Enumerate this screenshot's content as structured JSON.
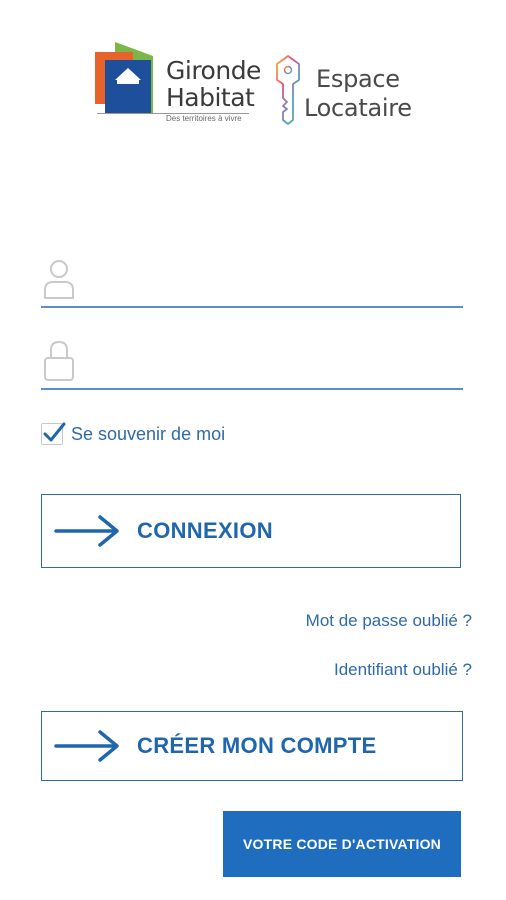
{
  "brand": {
    "gironde_line1": "Gironde",
    "gironde_line2": "Habitat",
    "tagline": "Des territoires à vivre",
    "espace_line1": "Espace",
    "espace_line2": "Locataire"
  },
  "form": {
    "username": {
      "value": "",
      "placeholder": ""
    },
    "password": {
      "value": "",
      "placeholder": ""
    },
    "remember_label": "Se souvenir de moi",
    "remember_checked": true
  },
  "actions": {
    "connexion_label": "CONNEXION",
    "forgot_password": "Mot de passe oublié ?",
    "forgot_id": "Identifiant oublié ?",
    "create_account_label": "CRÉER MON COMPTE",
    "activation_label": "VOTRE CODE D'ACTIVATION"
  },
  "colors": {
    "accent": "#1f66ad",
    "link": "#2f6aa8",
    "activation_bg": "#1f6dbf",
    "field_line": "#5b8ec6"
  },
  "icons": {
    "username": "user-icon",
    "password": "lock-icon",
    "checkbox": "checkmark-icon",
    "buttons": "arrow-right-icon",
    "logo_key": "key-icon"
  }
}
